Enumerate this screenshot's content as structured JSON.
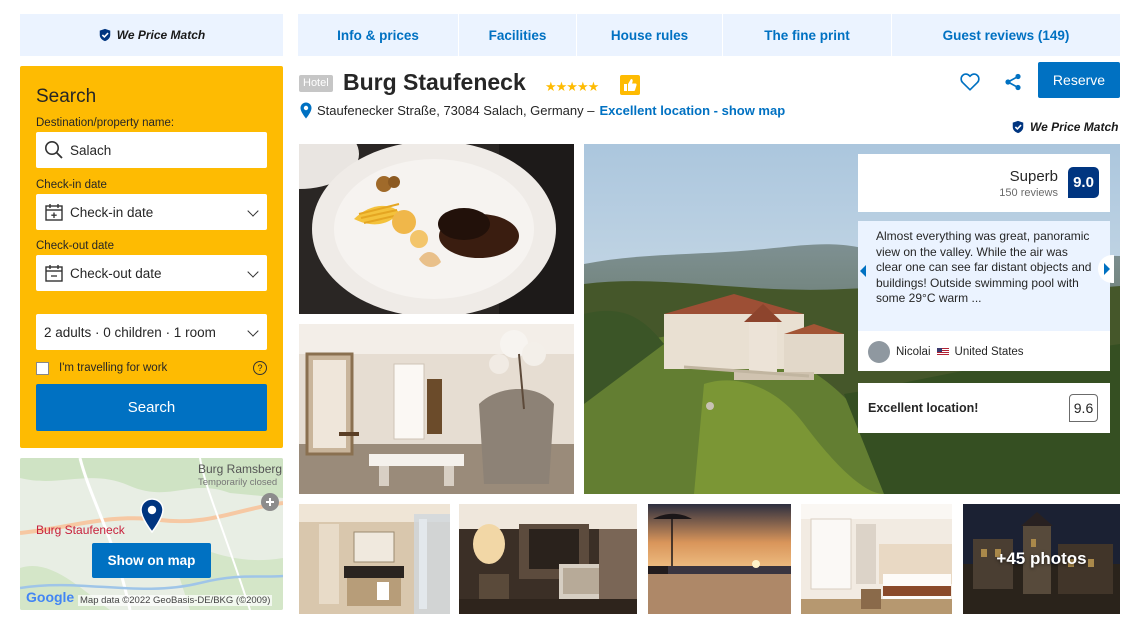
{
  "price_match": {
    "label": "We Price Match"
  },
  "tabs": [
    {
      "label": "Info & prices"
    },
    {
      "label": "Facilities"
    },
    {
      "label": "House rules"
    },
    {
      "label": "The fine print"
    },
    {
      "label": "Guest reviews (149)"
    }
  ],
  "search": {
    "title": "Search",
    "destination_label": "Destination/property name:",
    "destination_value": "Salach",
    "checkin_label": "Check-in date",
    "checkin_value": "Check-in date",
    "checkout_label": "Check-out date",
    "checkout_value": "Check-out date",
    "guests_value": "2 adults · 0 children · 1 room",
    "work_label": "I'm travelling for work",
    "help_symbol": "?",
    "button_label": "Search"
  },
  "map": {
    "place_label": "Burg Staufeneck",
    "nearby_label": "Burg Ramsberg",
    "nearby_sub": "Temporarily closed",
    "button_label": "Show on map",
    "google_label": "Google",
    "attribution": "Map data ©2022 GeoBasis-DE/BKG (©2009)"
  },
  "hotel": {
    "type_badge": "Hotel",
    "name": "Burg Staufeneck",
    "stars": "★★★★★",
    "address": "Staufenecker Straße, 73084 Salach, Germany –",
    "location_link": "Excellent location - show map",
    "reserve_label": "Reserve",
    "price_match_label": "We Price Match"
  },
  "reviews": {
    "score_word": "Superb",
    "score_count": "150 reviews",
    "score": "9.0",
    "quote": "Almost everything was great, panoramic view on the valley. While the air was clear one can see far distant objects and buildings! Outside swimming pool with some 29°C warm ...",
    "reviewer_name": "Nicolai",
    "reviewer_country": "United States",
    "location_label": "Excellent location!",
    "location_score": "9.6"
  },
  "gallery": {
    "more_photos": "+45 photos"
  },
  "colors": {
    "brand_blue": "#0071c2",
    "dark_blue": "#003580",
    "yellow": "#febb02",
    "light_blue_bg": "#ebf3ff"
  }
}
